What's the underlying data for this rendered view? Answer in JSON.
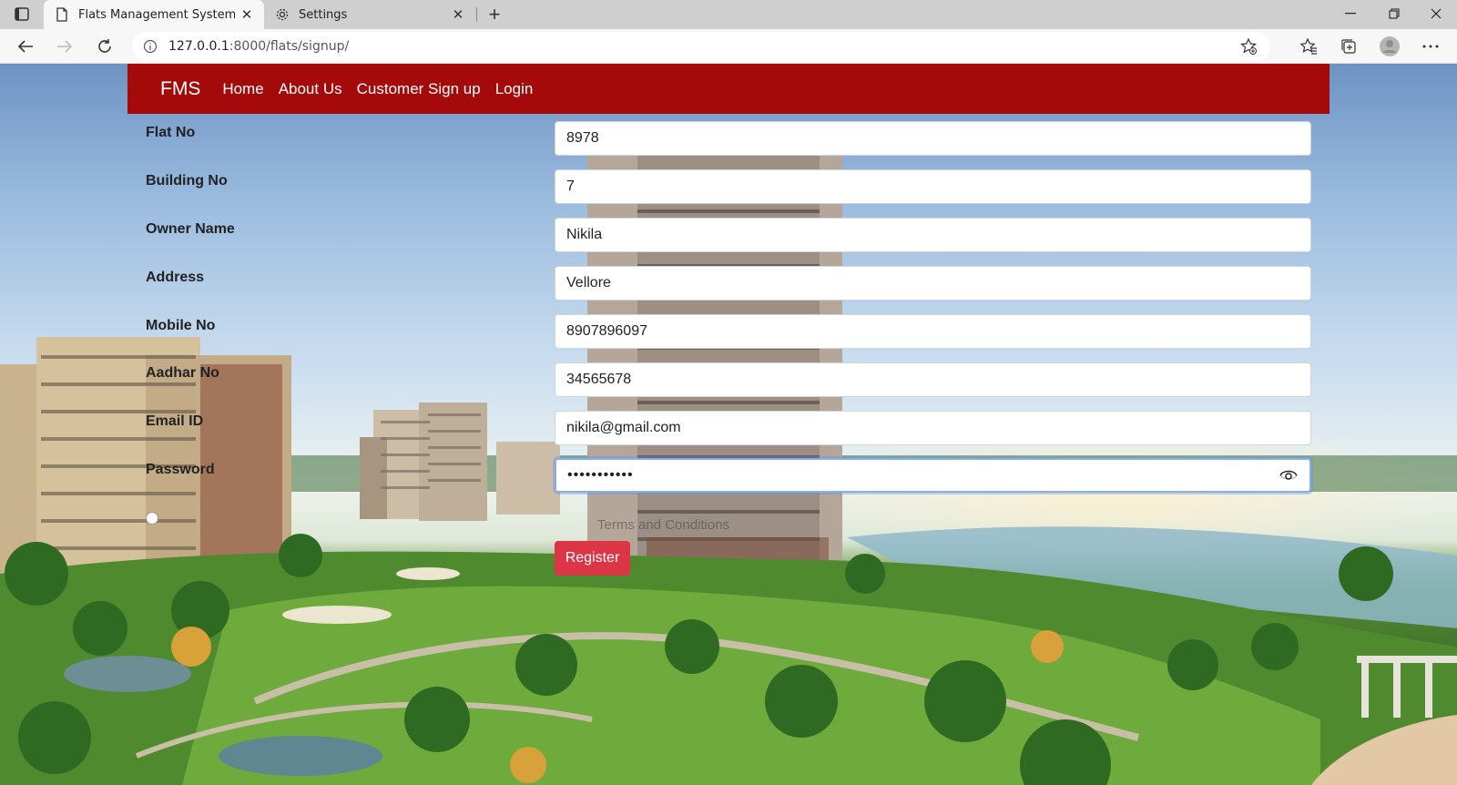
{
  "browser": {
    "tabs": [
      {
        "title": "Flats Management System",
        "active": true,
        "icon": "page-icon"
      },
      {
        "title": "Settings",
        "active": false,
        "icon": "gear-icon"
      }
    ],
    "url": {
      "host": "127.0.0.1",
      "path": ":8000/flats/signup/"
    }
  },
  "navbar": {
    "brand": "FMS",
    "links": [
      "Home",
      "About Us",
      "Customer Sign up",
      "Login"
    ],
    "color": "#a50a0a"
  },
  "form": {
    "fields": [
      {
        "label": "Flat No",
        "value": "8978"
      },
      {
        "label": "Building No",
        "value": "7"
      },
      {
        "label": "Owner Name",
        "value": "Nikila"
      },
      {
        "label": "Address",
        "value": "Vellore"
      },
      {
        "label": "Mobile No",
        "value": "8907896097"
      },
      {
        "label": "Aadhar No",
        "value": "34565678"
      },
      {
        "label": "Email ID",
        "value": "nikila@gmail.com"
      },
      {
        "label": "Password",
        "value": "•••••••••••"
      }
    ],
    "terms": "Terms and Conditions",
    "register_label": "Register",
    "register_color": "#dc3545"
  }
}
